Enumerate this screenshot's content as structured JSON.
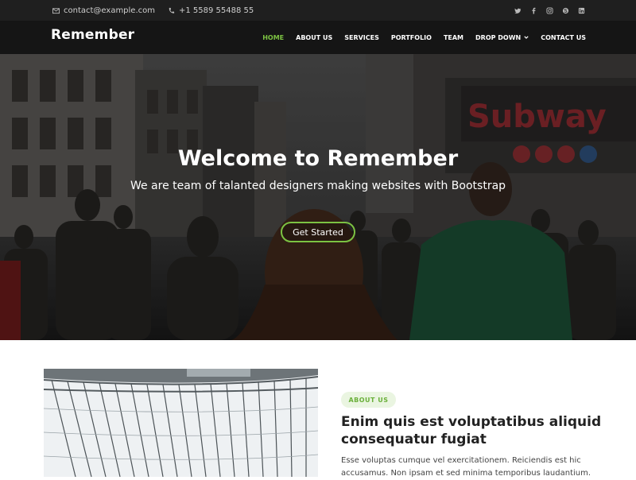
{
  "topbar": {
    "email": "contact@example.com",
    "phone": "+1 5589 55488 55",
    "email_icon": "envelope-icon",
    "phone_icon": "phone-icon",
    "social": [
      "twitter-icon",
      "facebook-icon",
      "instagram-icon",
      "skype-icon",
      "linkedin-icon"
    ]
  },
  "header": {
    "logo": "Remember",
    "nav": [
      {
        "label": "HOME",
        "active": true
      },
      {
        "label": "ABOUT US"
      },
      {
        "label": "SERVICES"
      },
      {
        "label": "PORTFOLIO"
      },
      {
        "label": "TEAM"
      },
      {
        "label": "DROP DOWN",
        "has_dropdown": true
      },
      {
        "label": "CONTACT US"
      }
    ]
  },
  "hero": {
    "title": "Welcome to Remember",
    "subtitle": "We are team of talanted designers making websites with Bootstrap",
    "cta": "Get Started",
    "background_sign": "Subway"
  },
  "about": {
    "badge": "ABOUT US",
    "title": "Enim quis est voluptatibus aliquid consequatur fugiat",
    "text": "Esse voluptas cumque vel exercitationem. Reiciendis est hic accusamus. Non ipsam et sed minima temporibus laudantium."
  },
  "colors": {
    "accent": "#7cc242",
    "topbar_bg": "#1f1f1f",
    "header_bg": "#151515",
    "badge_bg": "#eaf5e1"
  }
}
